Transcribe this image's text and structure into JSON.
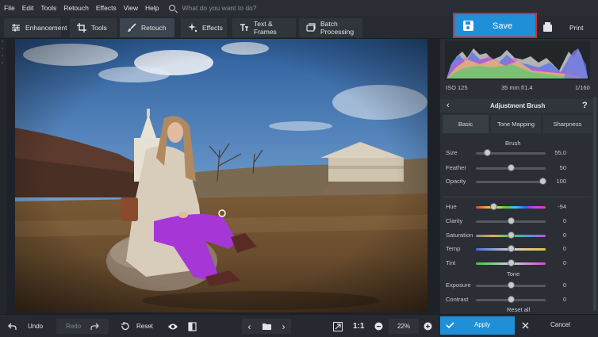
{
  "menu": [
    "File",
    "Edit",
    "Tools",
    "Retouch",
    "Effects",
    "View",
    "Help"
  ],
  "search": {
    "placeholder": "What do you want to do?"
  },
  "tabs": [
    {
      "label": "Enhancement",
      "icon": "sliders-icon"
    },
    {
      "label": "Tools",
      "icon": "crop-icon"
    },
    {
      "label": "Retouch",
      "icon": "brush-icon",
      "active": true
    },
    {
      "label": "Effects",
      "icon": "sparkle-icon"
    },
    {
      "label": "Text & Frames",
      "icon": "text-icon"
    },
    {
      "label": "Batch Processing",
      "icon": "batch-icon"
    }
  ],
  "save_label": "Save",
  "print_label": "Print",
  "histogram": {
    "iso": "ISO 125",
    "lens": "35 mm f/1.4",
    "shutter": "1/160"
  },
  "panel": {
    "title": "Adjustment Brush",
    "subtabs": [
      "Basic",
      "Tone Mapping",
      "Sharpness"
    ],
    "brush_section": "Brush",
    "tone_section": "Tone",
    "reset_all": "Reset all"
  },
  "sliders": [
    {
      "label": "Size",
      "value": "55,0",
      "level": 0.16,
      "track": "gray"
    },
    {
      "label": "Feather",
      "value": "50",
      "level": 0.5,
      "track": "gray"
    },
    {
      "label": "Opacity",
      "value": "100",
      "level": 0.96,
      "track": "gray"
    },
    {
      "label": "Hue",
      "value": "-94",
      "level": 0.26,
      "track": "rainbow"
    },
    {
      "label": "Clarity",
      "value": "0",
      "level": 0.5,
      "track": "gray"
    },
    {
      "label": "Saturation",
      "value": "0",
      "level": 0.5,
      "track": "sat"
    },
    {
      "label": "Temp",
      "value": "0",
      "level": 0.5,
      "track": "temp"
    },
    {
      "label": "Tint",
      "value": "0",
      "level": 0.5,
      "track": "tint"
    },
    {
      "label": "Exposure",
      "value": "0",
      "level": 0.5,
      "track": "gray"
    },
    {
      "label": "Contrast",
      "value": "0",
      "level": 0.5,
      "track": "gray"
    }
  ],
  "bottom": {
    "undo": "Undo",
    "redo": "Redo",
    "reset": "Reset",
    "ratio": "1:1",
    "zoom": "22%",
    "apply": "Apply",
    "cancel": "Cancel"
  },
  "colors": {
    "accent": "#1f8fd8",
    "highlight_border": "#e0262e",
    "brushed_coat": "#a637d6"
  }
}
